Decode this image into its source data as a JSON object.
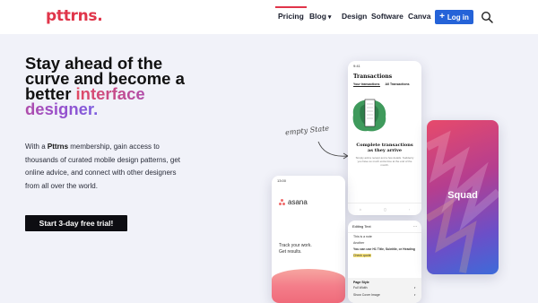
{
  "header": {
    "logo": "pttrns.",
    "nav": [
      {
        "label": "Pricing",
        "active": true
      },
      {
        "label": "Blog",
        "dropdown": true
      },
      {
        "label": "Design"
      },
      {
        "label": "Software"
      },
      {
        "label": "Canva"
      }
    ],
    "login_label": "Log in"
  },
  "hero": {
    "headline_plain": "Stay ahead of the curve and become a better",
    "headline_accent": "interface designer.",
    "desc_prefix": "With a",
    "desc_brand": "Pttrns",
    "desc_suffix": "membership, gain access to thousands of curated mobile design patterns, get online advice, and connect with other designers from all over the world.",
    "cta_label": "Start 3-day free trial!"
  },
  "annotation": "empty State",
  "phones": {
    "transactions": {
      "time": "9:41",
      "title": "Transactions",
      "tab1": "Your transactions",
      "tab2": "All Transactions",
      "heading": "Complete transactions as they arrive",
      "sub": "Simply add a receipt and a few details. Suddenly you have so much extra time at the end of the month."
    },
    "asana": {
      "time": "13:00",
      "brand": "asana",
      "tagline1": "Track your work.",
      "tagline2": "Get results."
    },
    "editor": {
      "left": "Editing Text",
      "lines": [
        "This is a note",
        "Another",
        "You can use H1 Title, Subtitle, or Heading",
        "Check quote"
      ],
      "sheet_title": "Page Style",
      "sheet_row1": "Full Width",
      "sheet_row2": "Show Cover Image"
    },
    "squad": {
      "label": "Squad"
    }
  },
  "colors": {
    "brand": "#e0354a",
    "login": "#2563d8",
    "cta": "#0d0d12"
  }
}
